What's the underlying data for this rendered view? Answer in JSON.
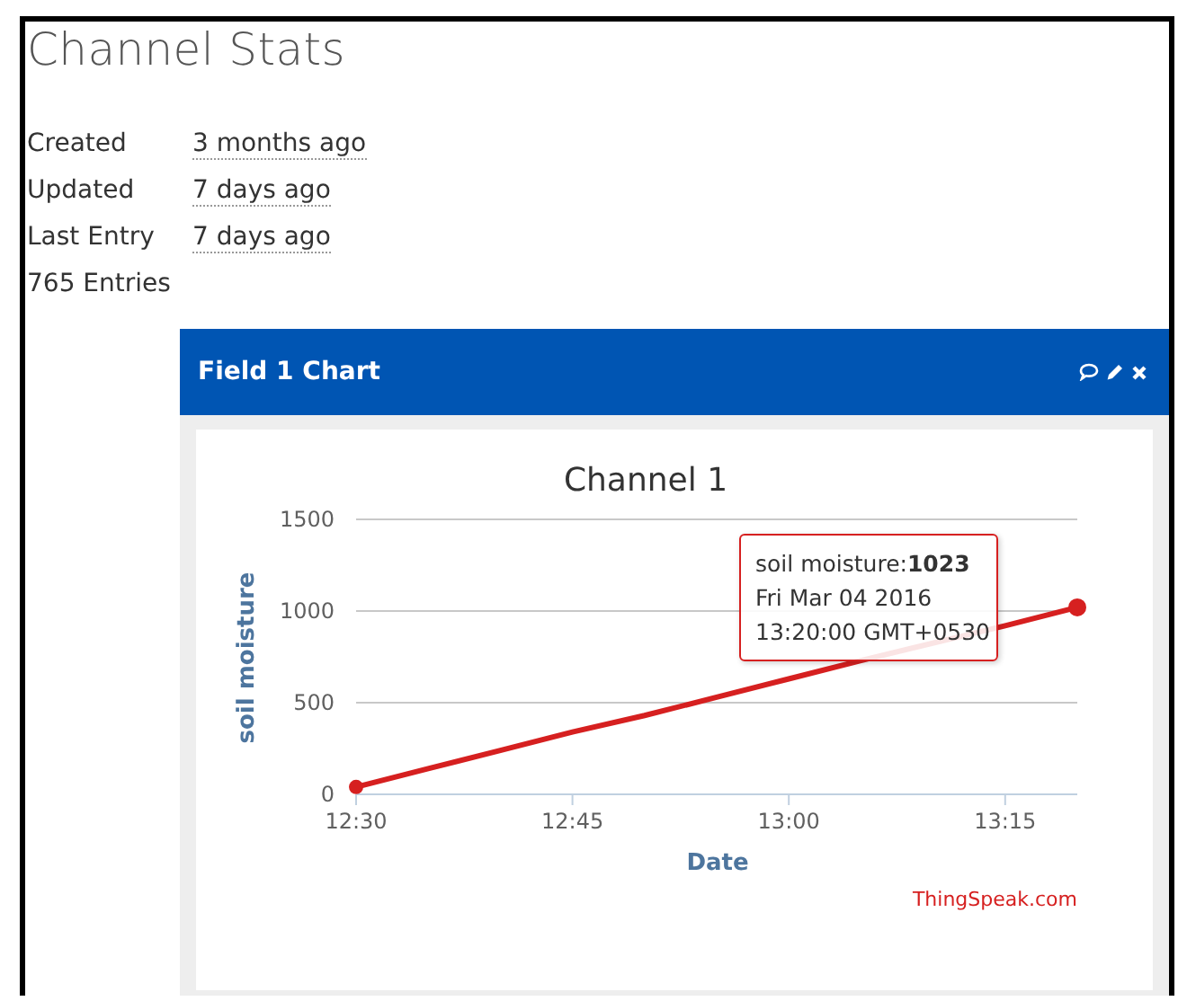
{
  "title": "Channel Stats",
  "stats": [
    {
      "label": "Created",
      "value": "3 months ago"
    },
    {
      "label": "Updated",
      "value": "7 days ago"
    },
    {
      "label": "Last Entry",
      "value": "7 days ago"
    }
  ],
  "entries": "765 Entries",
  "panel": {
    "title": "Field 1 Chart",
    "chart_data": {
      "type": "line",
      "title": "Channel 1",
      "xlabel": "Date",
      "ylabel": "soil moisture",
      "categories": [
        "12:30",
        null,
        null,
        "12:45",
        null,
        null,
        "13:00",
        null,
        null,
        "13:15",
        null
      ],
      "series": [
        {
          "color": "#d62020",
          "values": [
            40,
            140,
            240,
            340,
            430,
            530,
            630,
            730,
            null,
            920,
            1020
          ]
        }
      ],
      "ylim": [
        0,
        1500
      ],
      "yticks": [
        0,
        500,
        1000,
        1500
      ]
    },
    "tooltip": [
      "soil moisture:**1023**",
      "Fri Mar 04 2016",
      "13:20:00 GMT+0530"
    ],
    "credit": "ThingSpeak.com"
  }
}
